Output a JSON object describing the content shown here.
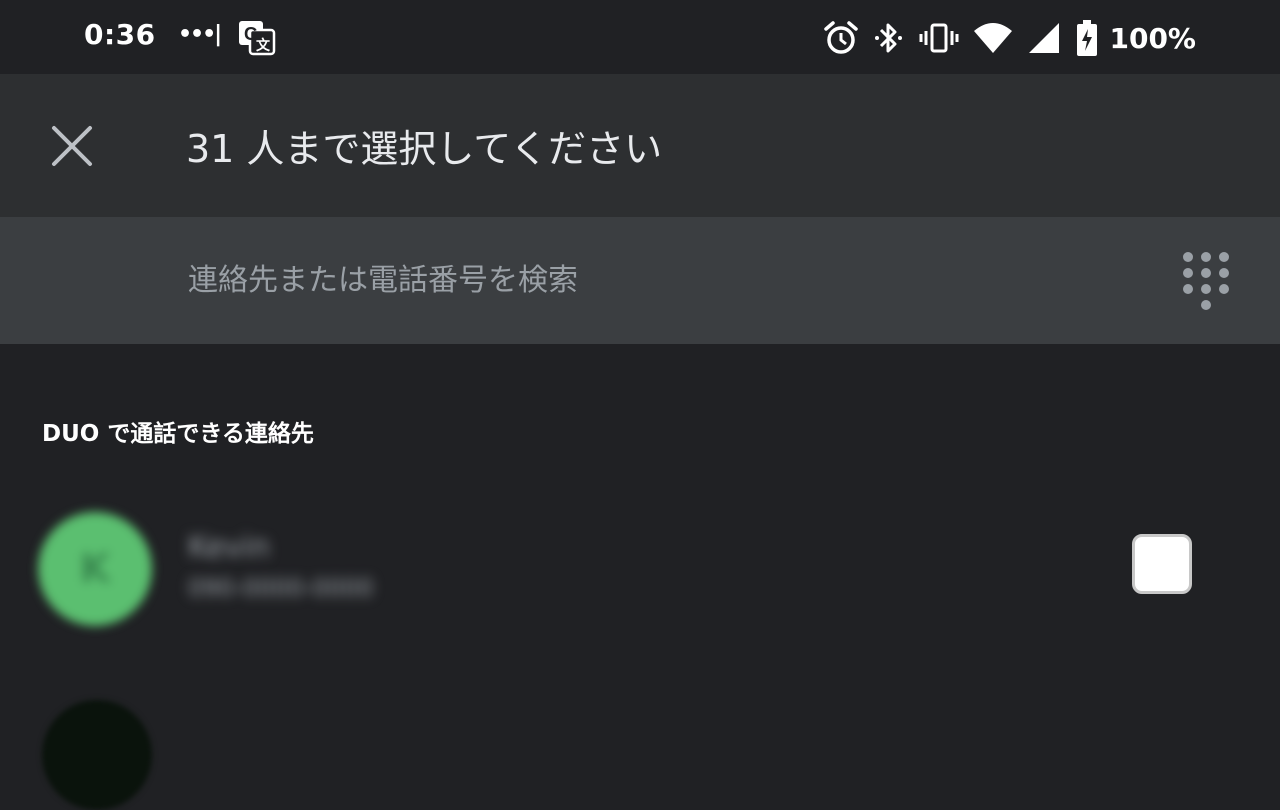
{
  "status_bar": {
    "time": "0:36",
    "notification_dots": "•••|",
    "battery_percent": "100%",
    "icons": [
      "google-translate-icon",
      "alarm-icon",
      "bluetooth-icon",
      "vibrate-icon",
      "wifi-icon",
      "cell-signal-icon",
      "battery-charging-icon"
    ]
  },
  "app_bar": {
    "title": "31 人まで選択してください",
    "close_icon": "close-icon"
  },
  "search": {
    "placeholder": "連絡先または電話番号を検索",
    "value": "",
    "dialpad_icon": "dialpad-icon"
  },
  "section_header": "DUO で通話できる連絡先",
  "contacts": [
    {
      "name": "Kevin",
      "number": "090-0000-0000",
      "avatar_letter": "K",
      "avatar_color": "#5bbf70",
      "checked": false,
      "obscured": true
    }
  ],
  "colors": {
    "background": "#202124",
    "app_bar": "#2d2f31",
    "search_bar": "#3b3e41",
    "avatar_green": "#5bbf70"
  }
}
